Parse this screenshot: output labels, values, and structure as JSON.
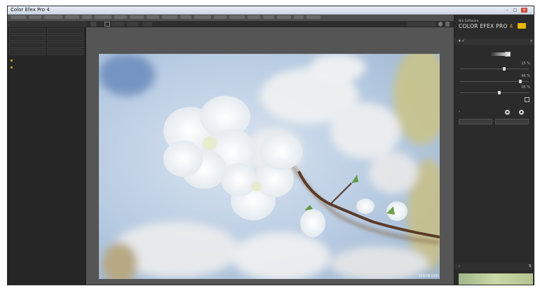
{
  "window": {
    "title": "Color Efex Pro 4"
  },
  "left_panel": {
    "header": "",
    "preset_cells": [
      "",
      "",
      "",
      "",
      "",
      "",
      "",
      ""
    ],
    "items": [
      {
        "label": ""
      },
      {
        "label": ""
      }
    ]
  },
  "toolbar": {
    "buttons": [
      "",
      "",
      ""
    ],
    "right_label": ""
  },
  "photo": {
    "camera_label": "NIKON D80"
  },
  "right_panel": {
    "brand_small": "Nik Software",
    "brand": "COLOR EFEX PRO",
    "brand_num": "4",
    "filter_name": "",
    "sliders": [
      {
        "label": "",
        "value": "15 %",
        "level": 0.62
      },
      {
        "label": "",
        "value": "46 %",
        "level": 0.86
      },
      {
        "label": "",
        "value": "35 %",
        "level": 0.55
      }
    ],
    "control_label": "",
    "section_label": "",
    "add_filter_label": "",
    "save_preset_label": "",
    "bottom_label": ""
  },
  "colors": {
    "accent": "#e08a2a",
    "panel": "#2b2b2b",
    "canvas_bg": "#555555"
  }
}
